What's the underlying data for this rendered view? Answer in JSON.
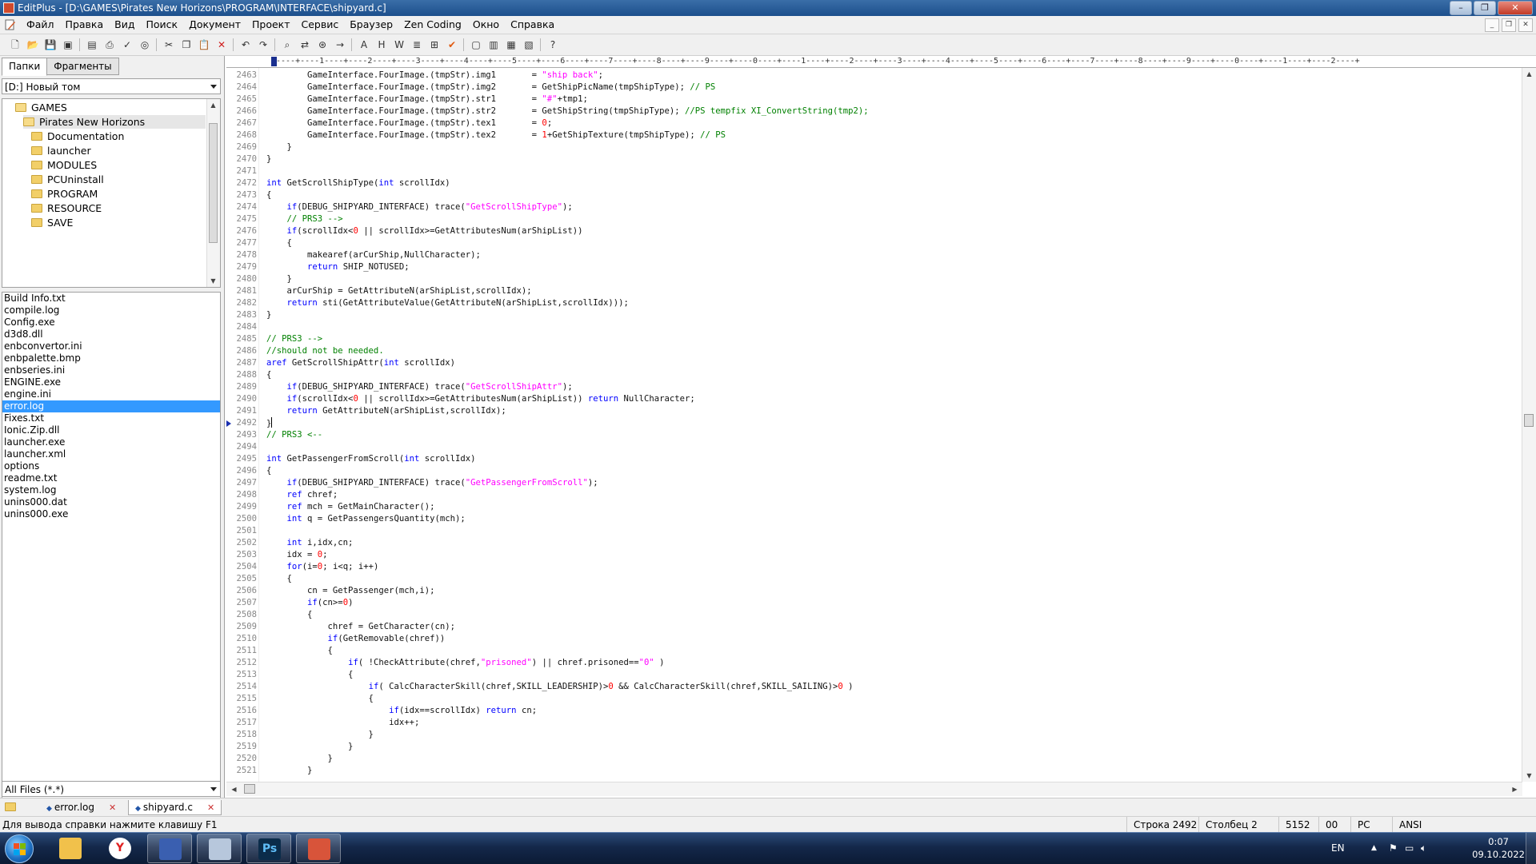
{
  "window": {
    "title": "EditPlus - [D:\\GAMES\\Pirates New Horizons\\PROGRAM\\INTERFACE\\shipyard.c]",
    "controls": [
      "–",
      "❐",
      "✕"
    ]
  },
  "menu": {
    "items": [
      "Файл",
      "Правка",
      "Вид",
      "Поиск",
      "Документ",
      "Проект",
      "Сервис",
      "Браузер",
      "Zen Coding",
      "Окно",
      "Справка"
    ],
    "mdi_controls": [
      "_",
      "❐",
      "✕"
    ]
  },
  "toolbar": {
    "groups": [
      [
        "new-file-icon",
        "open-file-icon",
        "save-icon",
        "save-all-icon"
      ],
      [
        "print-preview-icon",
        "print-icon",
        "spellcheck-icon",
        "browser-preview-icon"
      ],
      [
        "cut-icon",
        "copy-icon",
        "paste-icon",
        "delete-icon"
      ],
      [
        "undo-icon",
        "redo-icon"
      ],
      [
        "find-icon",
        "replace-icon",
        "find-in-files-icon",
        "goto-line-icon"
      ],
      [
        "font-icon",
        "hex-icon",
        "word-wrap-icon",
        "line-numbers-icon",
        "ruler-icon",
        "check-icon"
      ],
      [
        "window-1-icon",
        "window-2-icon",
        "window-3-icon",
        "window-4-icon"
      ],
      [
        "help-icon"
      ]
    ]
  },
  "left_panel": {
    "tabs": [
      "Папки",
      "Фрагменты"
    ],
    "drive": "[D:] Новый том",
    "tree": [
      {
        "label": "GAMES",
        "level": 0,
        "open": true
      },
      {
        "label": "Pirates New Horizons",
        "level": 1,
        "open": true,
        "selected": true
      },
      {
        "label": "Documentation",
        "level": 2
      },
      {
        "label": "launcher",
        "level": 2
      },
      {
        "label": "MODULES",
        "level": 2
      },
      {
        "label": "PCUninstall",
        "level": 2
      },
      {
        "label": "PROGRAM",
        "level": 2
      },
      {
        "label": "RESOURCE",
        "level": 2
      },
      {
        "label": "SAVE",
        "level": 2
      }
    ],
    "files": [
      "Build Info.txt",
      "compile.log",
      "Config.exe",
      "d3d8.dll",
      "enbconvertor.ini",
      "enbpalette.bmp",
      "enbseries.ini",
      "ENGINE.exe",
      "engine.ini",
      "error.log",
      "Fixes.txt",
      "Ionic.Zip.dll",
      "launcher.exe",
      "launcher.xml",
      "options",
      "readme.txt",
      "system.log",
      "unins000.dat",
      "unins000.exe"
    ],
    "selected_file": "error.log",
    "filter": "All Files (*.*)"
  },
  "editor": {
    "ruler": "----+----1----+----2----+----3----+----4----+----5----+----6----+----7----+----8----+----9----+----0----+----1----+----2----+----3----+----4----+----5----+----6----+----7----+----8----+----9----+----0----+----1----+----2----+",
    "current_line": "2492",
    "lines": [
      {
        "n": "2463",
        "code": "        GameInterface.FourImage.(tmpStr).img1       = \"ship back\";"
      },
      {
        "n": "2464",
        "code": "        GameInterface.FourImage.(tmpStr).img2       = GetShipPicName(tmpShipType); // PS"
      },
      {
        "n": "2465",
        "code": "        GameInterface.FourImage.(tmpStr).str1       = \"#\"+tmp1;"
      },
      {
        "n": "2466",
        "code": "        GameInterface.FourImage.(tmpStr).str2       = GetShipString(tmpShipType); //PS tempfix XI_ConvertString(tmp2);"
      },
      {
        "n": "2467",
        "code": "        GameInterface.FourImage.(tmpStr).tex1       = 0;"
      },
      {
        "n": "2468",
        "code": "        GameInterface.FourImage.(tmpStr).tex2       = 1+GetShipTexture(tmpShipType); // PS"
      },
      {
        "n": "2469",
        "code": "    }"
      },
      {
        "n": "2470",
        "code": "}"
      },
      {
        "n": "2471",
        "code": ""
      },
      {
        "n": "2472",
        "code": "int GetScrollShipType(int scrollIdx)"
      },
      {
        "n": "2473",
        "code": "{"
      },
      {
        "n": "2474",
        "code": "    if(DEBUG_SHIPYARD_INTERFACE) trace(\"GetScrollShipType\");"
      },
      {
        "n": "2475",
        "code": "    // PRS3 -->"
      },
      {
        "n": "2476",
        "code": "    if(scrollIdx<0 || scrollIdx>=GetAttributesNum(arShipList))"
      },
      {
        "n": "2477",
        "code": "    {"
      },
      {
        "n": "2478",
        "code": "        makearef(arCurShip,NullCharacter);"
      },
      {
        "n": "2479",
        "code": "        return SHIP_NOTUSED;"
      },
      {
        "n": "2480",
        "code": "    }"
      },
      {
        "n": "2481",
        "code": "    arCurShip = GetAttributeN(arShipList,scrollIdx);"
      },
      {
        "n": "2482",
        "code": "    return sti(GetAttributeValue(GetAttributeN(arShipList,scrollIdx)));"
      },
      {
        "n": "2483",
        "code": "}"
      },
      {
        "n": "2484",
        "code": ""
      },
      {
        "n": "2485",
        "code": "// PRS3 -->"
      },
      {
        "n": "2486",
        "code": "//should not be needed."
      },
      {
        "n": "2487",
        "code": "aref GetScrollShipAttr(int scrollIdx)"
      },
      {
        "n": "2488",
        "code": "{"
      },
      {
        "n": "2489",
        "code": "    if(DEBUG_SHIPYARD_INTERFACE) trace(\"GetScrollShipAttr\");"
      },
      {
        "n": "2490",
        "code": "    if(scrollIdx<0 || scrollIdx>=GetAttributesNum(arShipList)) return NullCharacter;"
      },
      {
        "n": "2491",
        "code": "    return GetAttributeN(arShipList,scrollIdx);"
      },
      {
        "n": "2492",
        "code": "}"
      },
      {
        "n": "2493",
        "code": "// PRS3 <--"
      },
      {
        "n": "2494",
        "code": ""
      },
      {
        "n": "2495",
        "code": "int GetPassengerFromScroll(int scrollIdx)"
      },
      {
        "n": "2496",
        "code": "{"
      },
      {
        "n": "2497",
        "code": "    if(DEBUG_SHIPYARD_INTERFACE) trace(\"GetPassengerFromScroll\");"
      },
      {
        "n": "2498",
        "code": "    ref chref;"
      },
      {
        "n": "2499",
        "code": "    ref mch = GetMainCharacter();"
      },
      {
        "n": "2500",
        "code": "    int q = GetPassengersQuantity(mch);"
      },
      {
        "n": "2501",
        "code": ""
      },
      {
        "n": "2502",
        "code": "    int i,idx,cn;"
      },
      {
        "n": "2503",
        "code": "    idx = 0;"
      },
      {
        "n": "2504",
        "code": "    for(i=0; i<q; i++)"
      },
      {
        "n": "2505",
        "code": "    {"
      },
      {
        "n": "2506",
        "code": "        cn = GetPassenger(mch,i);"
      },
      {
        "n": "2507",
        "code": "        if(cn>=0)"
      },
      {
        "n": "2508",
        "code": "        {"
      },
      {
        "n": "2509",
        "code": "            chref = GetCharacter(cn);"
      },
      {
        "n": "2510",
        "code": "            if(GetRemovable(chref))"
      },
      {
        "n": "2511",
        "code": "            {"
      },
      {
        "n": "2512",
        "code": "                if( !CheckAttribute(chref,\"prisoned\") || chref.prisoned==\"0\" )"
      },
      {
        "n": "2513",
        "code": "                {"
      },
      {
        "n": "2514",
        "code": "                    if( CalcCharacterSkill(chref,SKILL_LEADERSHIP)>0 && CalcCharacterSkill(chref,SKILL_SAILING)>0 )"
      },
      {
        "n": "2515",
        "code": "                    {"
      },
      {
        "n": "2516",
        "code": "                        if(idx==scrollIdx) return cn;"
      },
      {
        "n": "2517",
        "code": "                        idx++;"
      },
      {
        "n": "2518",
        "code": "                    }"
      },
      {
        "n": "2519",
        "code": "                }"
      },
      {
        "n": "2520",
        "code": "            }"
      },
      {
        "n": "2521",
        "code": "        }"
      }
    ]
  },
  "doc_tabs": [
    {
      "label": "error.log",
      "active": false
    },
    {
      "label": "shipyard.c",
      "active": true
    }
  ],
  "status": {
    "hint": "Для вывода справки нажмите клавишу F1",
    "line": "Строка 2492",
    "column": "Столбец 2",
    "chars": "5152",
    "code": "00",
    "eol": "PC",
    "encoding": "ANSI"
  },
  "taskbar": {
    "apps": [
      {
        "name": "explorer",
        "label": "",
        "color": "#f1c14b"
      },
      {
        "name": "yandex-browser",
        "label": "Y",
        "color": "#e02020"
      },
      {
        "name": "floppy-app",
        "label": "",
        "color": "#3a5fb0"
      },
      {
        "name": "calculator",
        "label": "",
        "color": "#b7c7dc"
      },
      {
        "name": "photoshop",
        "label": "Ps",
        "color": "#0b2c4a"
      },
      {
        "name": "editplus",
        "label": "",
        "color": "#d8543a"
      }
    ],
    "language": "EN",
    "time": "0:07",
    "date": "09.10.2022"
  },
  "colors": {
    "keyword": "#0000ff",
    "string": "#ff00ff",
    "comment": "#008000",
    "number": "#ff0000",
    "selection": "#3399ff"
  }
}
